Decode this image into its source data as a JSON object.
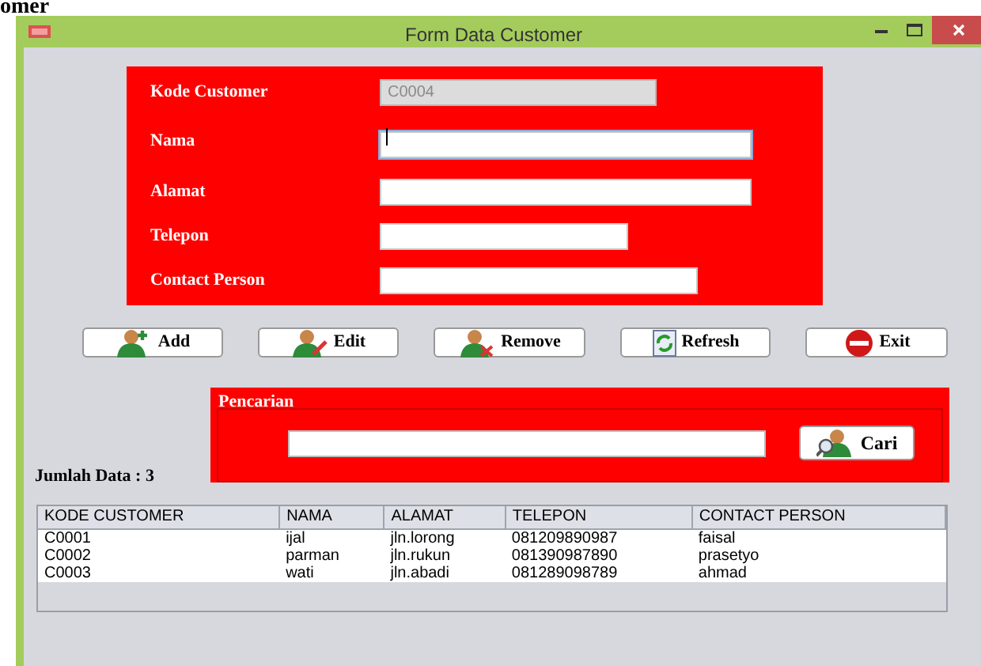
{
  "page_heading": "omer",
  "window": {
    "title": "Form Data Customer"
  },
  "form": {
    "fields": [
      {
        "label": "Kode Customer",
        "value": "C0004",
        "disabled": true,
        "focused": false
      },
      {
        "label": "Nama",
        "disabled": false,
        "focused": true
      },
      {
        "label": "Alamat",
        "disabled": false,
        "focused": false
      },
      {
        "label": "Telepon",
        "disabled": false,
        "focused": false
      },
      {
        "label": "Contact Person",
        "disabled": false,
        "focused": false
      }
    ]
  },
  "buttons": [
    {
      "label": "Add",
      "kind": "add"
    },
    {
      "label": "Edit",
      "kind": "edit"
    },
    {
      "label": "Remove",
      "kind": "remove"
    },
    {
      "label": "Refresh",
      "kind": "refresh"
    },
    {
      "label": "Exit",
      "kind": "exit"
    }
  ],
  "search": {
    "title": "Pencarian",
    "button": "Cari"
  },
  "count_label": "Jumlah Data : 3",
  "table": {
    "columns": [
      "KODE CUSTOMER",
      "NAMA",
      "ALAMAT",
      "TELEPON",
      "CONTACT PERSON"
    ],
    "rows": [
      [
        "C0001",
        "ijal",
        "jln.lorong",
        "081209890987",
        "faisal"
      ],
      [
        "C0002",
        "parman",
        "jln.rukun",
        "081390987890",
        "prasetyo"
      ],
      [
        "C0003",
        "wati",
        "jln.abadi",
        "081289098789",
        "ahmad"
      ]
    ]
  }
}
